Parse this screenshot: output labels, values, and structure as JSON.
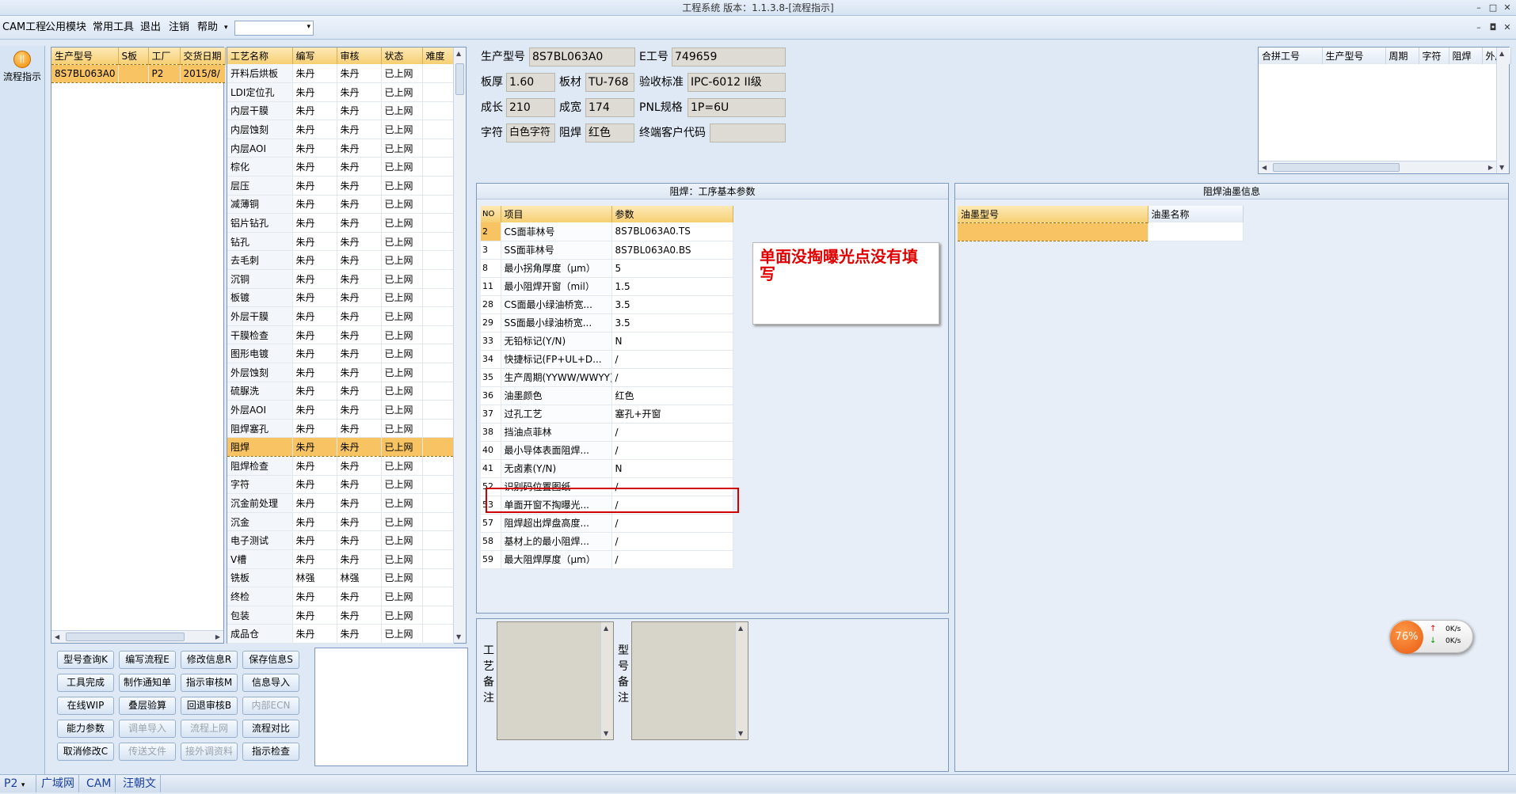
{
  "window": {
    "title": "工程系统 版本：1.1.3.8-[流程指示]",
    "minimize": "–",
    "restore": "□",
    "close": "✕"
  },
  "menubar": {
    "items": [
      "CAM工程",
      "公用模块",
      "常用工具",
      "退出",
      "注销",
      "帮助"
    ],
    "combo_arrow": "▾"
  },
  "menubar_right": {
    "minimize": "–",
    "restore": "◘",
    "close": "✕"
  },
  "leftstrip": {
    "flow_button": "流程指示",
    "flow_icon_glyph": "||"
  },
  "orders": {
    "headers": [
      "生产型号",
      "S板",
      "工厂",
      "交货日期"
    ],
    "rows": [
      [
        "8S7BL063A0",
        "",
        "P2",
        "2015/8/"
      ]
    ]
  },
  "processes": {
    "headers": [
      "工艺名称",
      "编写",
      "审核",
      "状态",
      "难度"
    ],
    "selected_index": 20,
    "rows": [
      [
        "开料后烘板",
        "朱丹",
        "朱丹",
        "已上网"
      ],
      [
        "LDI定位孔",
        "朱丹",
        "朱丹",
        "已上网"
      ],
      [
        "内层干膜",
        "朱丹",
        "朱丹",
        "已上网"
      ],
      [
        "内层蚀刻",
        "朱丹",
        "朱丹",
        "已上网"
      ],
      [
        "内层AOI",
        "朱丹",
        "朱丹",
        "已上网"
      ],
      [
        "棕化",
        "朱丹",
        "朱丹",
        "已上网"
      ],
      [
        "层压",
        "朱丹",
        "朱丹",
        "已上网"
      ],
      [
        "减薄铜",
        "朱丹",
        "朱丹",
        "已上网"
      ],
      [
        "铝片钻孔",
        "朱丹",
        "朱丹",
        "已上网"
      ],
      [
        "钻孔",
        "朱丹",
        "朱丹",
        "已上网"
      ],
      [
        "去毛刺",
        "朱丹",
        "朱丹",
        "已上网"
      ],
      [
        "沉铜",
        "朱丹",
        "朱丹",
        "已上网"
      ],
      [
        "板镀",
        "朱丹",
        "朱丹",
        "已上网"
      ],
      [
        "外层干膜",
        "朱丹",
        "朱丹",
        "已上网"
      ],
      [
        "干膜检查",
        "朱丹",
        "朱丹",
        "已上网"
      ],
      [
        "图形电镀",
        "朱丹",
        "朱丹",
        "已上网"
      ],
      [
        "外层蚀刻",
        "朱丹",
        "朱丹",
        "已上网"
      ],
      [
        "硫脲洗",
        "朱丹",
        "朱丹",
        "已上网"
      ],
      [
        "外层AOI",
        "朱丹",
        "朱丹",
        "已上网"
      ],
      [
        "阻焊塞孔",
        "朱丹",
        "朱丹",
        "已上网"
      ],
      [
        "阻焊",
        "朱丹",
        "朱丹",
        "已上网"
      ],
      [
        "阻焊检查",
        "朱丹",
        "朱丹",
        "已上网"
      ],
      [
        "字符",
        "朱丹",
        "朱丹",
        "已上网"
      ],
      [
        "沉金前处理",
        "朱丹",
        "朱丹",
        "已上网"
      ],
      [
        "沉金",
        "朱丹",
        "朱丹",
        "已上网"
      ],
      [
        "电子测试",
        "朱丹",
        "朱丹",
        "已上网"
      ],
      [
        "V槽",
        "朱丹",
        "朱丹",
        "已上网"
      ],
      [
        "铣板",
        "林强",
        "林强",
        "已上网"
      ],
      [
        "终检",
        "朱丹",
        "朱丹",
        "已上网"
      ],
      [
        "包装",
        "朱丹",
        "朱丹",
        "已上网"
      ],
      [
        "成品仓",
        "朱丹",
        "朱丹",
        "已上网"
      ]
    ]
  },
  "buttons": [
    {
      "label": "型号查询K",
      "enabled": true
    },
    {
      "label": "编写流程E",
      "enabled": true
    },
    {
      "label": "修改信息R",
      "enabled": true
    },
    {
      "label": "保存信息S",
      "enabled": true
    },
    {
      "label": "工具完成",
      "enabled": true
    },
    {
      "label": "制作通知单",
      "enabled": true
    },
    {
      "label": "指示审核M",
      "enabled": true
    },
    {
      "label": "信息导入",
      "enabled": true
    },
    {
      "label": "在线WIP",
      "enabled": true
    },
    {
      "label": "叠层验算",
      "enabled": true
    },
    {
      "label": "回退审核B",
      "enabled": true
    },
    {
      "label": "内部ECN",
      "enabled": false
    },
    {
      "label": "能力参数",
      "enabled": true
    },
    {
      "label": "调单导入",
      "enabled": false
    },
    {
      "label": "流程上网",
      "enabled": false
    },
    {
      "label": "流程对比",
      "enabled": true
    },
    {
      "label": "取消修改C",
      "enabled": true
    },
    {
      "label": "传送文件",
      "enabled": false
    },
    {
      "label": "接外调资料",
      "enabled": false
    },
    {
      "label": "指示检查",
      "enabled": true
    }
  ],
  "info": {
    "model_label": "生产型号",
    "model_value": "8S7BL063A0",
    "eno_label": "E工号",
    "eno_value": "749659",
    "thick_label": "板厚",
    "thick_value": "1.60",
    "material_label": "板材",
    "material_value": "TU-768",
    "accept_label": "验收标准",
    "accept_value": "IPC-6012 II级",
    "length_label": "成长",
    "length_value": "210",
    "width_label": "成宽",
    "width_value": "174",
    "pnl_label": "PNL规格",
    "pnl_value": "1P=6U",
    "char_label": "字符",
    "char_value": "白色字符",
    "mask_label": "阻焊",
    "mask_value": "红色",
    "customer_label": "终端客户代码",
    "customer_value": ""
  },
  "merge": {
    "headers": [
      "合拼工号",
      "生产型号",
      "周期",
      "字符",
      "阻焊",
      "外层"
    ]
  },
  "params": {
    "title": "阻焊：工序基本参数",
    "headers": [
      "NO",
      "项目",
      "参数"
    ],
    "selected_index": 0,
    "rows": [
      [
        "2",
        "CS面菲林号",
        "8S7BL063A0.TS"
      ],
      [
        "3",
        "SS面菲林号",
        "8S7BL063A0.BS"
      ],
      [
        "8",
        "最小拐角厚度（μm）",
        "5"
      ],
      [
        "11",
        "最小阻焊开窗（mil）",
        "1.5"
      ],
      [
        "28",
        "CS面最小绿油桥宽...",
        "3.5"
      ],
      [
        "29",
        "SS面最小绿油桥宽...",
        "3.5"
      ],
      [
        "33",
        "无铅标记(Y/N)",
        "N"
      ],
      [
        "34",
        "快捷标记(FP+UL+D...",
        "/"
      ],
      [
        "35",
        "生产周期(YYWW/WWYY)",
        "/"
      ],
      [
        "36",
        "油墨颜色",
        "红色"
      ],
      [
        "37",
        "过孔工艺",
        "塞孔+开窗"
      ],
      [
        "38",
        "挡油点菲林",
        "/"
      ],
      [
        "40",
        "最小导体表面阻焊...",
        "/"
      ],
      [
        "41",
        "无卤素(Y/N)",
        "N"
      ],
      [
        "52",
        "识别码位置图纸",
        "/"
      ],
      [
        "53",
        "单面开窗不掏曝光...",
        "/"
      ],
      [
        "57",
        "阻焊超出焊盘高度...",
        "/"
      ],
      [
        "58",
        "基材上的最小阻焊...",
        "/"
      ],
      [
        "59",
        "最大阻焊厚度（μm）",
        "/"
      ]
    ]
  },
  "annotation": {
    "text": "单面没掏曝光点没有填写"
  },
  "ink": {
    "title": "阻焊油墨信息",
    "headers": [
      "油墨型号",
      "油墨名称"
    ]
  },
  "remarks": {
    "process_label": "工艺备注",
    "model_label": "型号备注"
  },
  "netmeter": {
    "percent": "76%",
    "up": "0K/s",
    "down": "0K/s",
    "up_arrow": "↑",
    "down_arrow": "↓"
  },
  "status": {
    "tabs": [
      "P2",
      "广域网",
      "CAM",
      "汪朝文"
    ],
    "arrow": "▾"
  },
  "colors": {
    "selected_row": "#f8c463",
    "header_gold": "#f6cf73",
    "annotation_red": "#e00000",
    "accent_blue": "#1a3f9c"
  }
}
